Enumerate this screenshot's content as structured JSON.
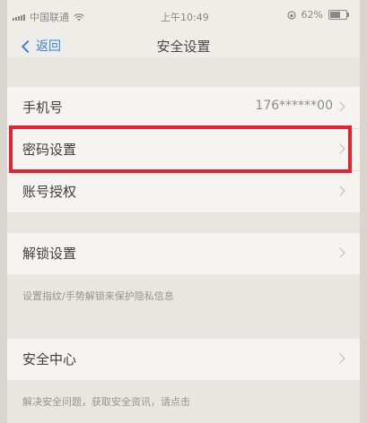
{
  "status_bar": {
    "carrier": "中国联通",
    "time": "上午10:49",
    "battery_percent": "62%",
    "battery_level": 0.62
  },
  "nav": {
    "back_label": "返回",
    "title": "安全设置"
  },
  "groups": [
    {
      "rows": [
        {
          "label": "手机号",
          "value": "176******00"
        },
        {
          "label": "密码设置",
          "value": ""
        },
        {
          "label": "账号授权",
          "value": ""
        }
      ]
    },
    {
      "rows": [
        {
          "label": "解锁设置",
          "value": ""
        }
      ],
      "caption": "设置指纹/手势解锁来保护隐私信息"
    },
    {
      "rows": [
        {
          "label": "安全中心",
          "value": ""
        }
      ],
      "caption": "解决安全问题，获取安全资讯，请点击"
    }
  ],
  "colors": {
    "accent": "#3b7fe0",
    "highlight": "#e5232f"
  }
}
